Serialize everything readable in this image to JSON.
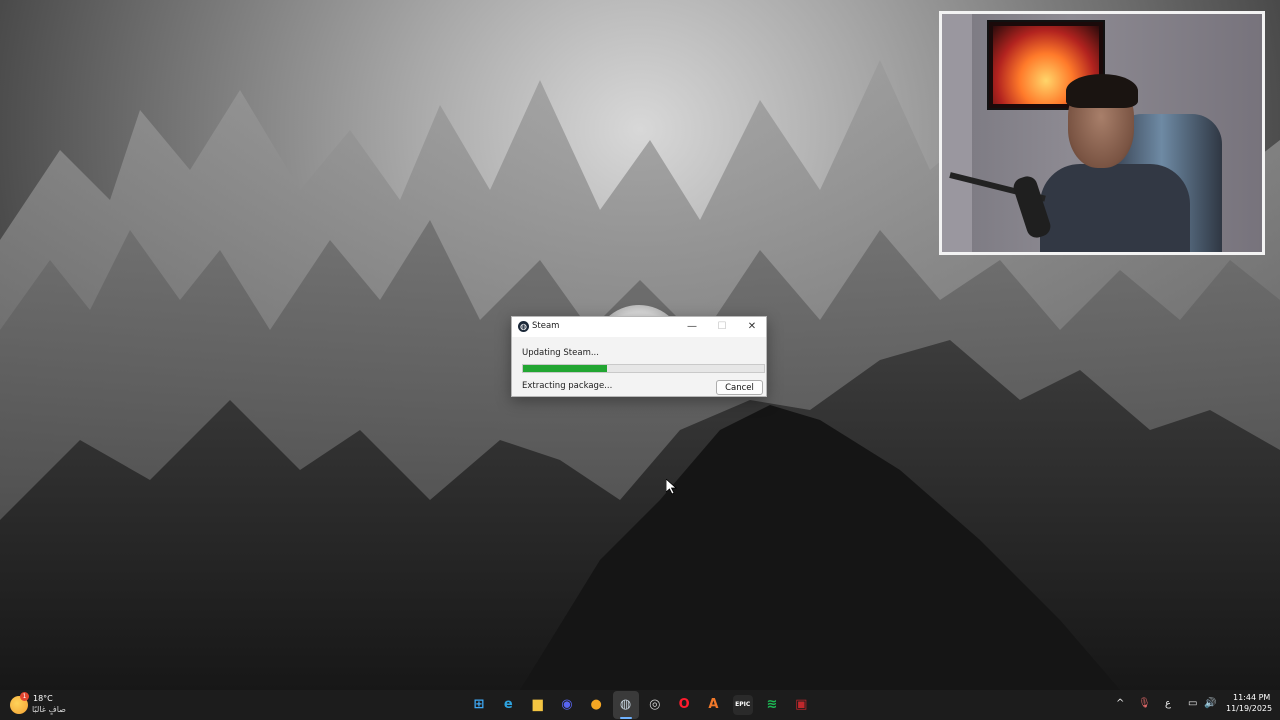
{
  "steam_dialog": {
    "title": "Steam",
    "status_main": "Updating Steam...",
    "status_sub": "Extracting package...",
    "cancel_label": "Cancel",
    "progress": 0.35,
    "progress_color": "#22a632",
    "minimize_glyph": "—",
    "maximize_glyph": "☐",
    "close_glyph": "✕"
  },
  "taskbar": {
    "weather": {
      "temperature": "18°C",
      "description": "صافٍ غالبًا",
      "badge": "1"
    },
    "apps": [
      {
        "name": "start-button",
        "icon": "windows-icon",
        "glyph": "⊞",
        "color": "#3fa9f5"
      },
      {
        "name": "edge-app",
        "icon": "edge-icon",
        "glyph": "e",
        "color": "#2ea3e0"
      },
      {
        "name": "file-explorer-app",
        "icon": "folder-icon",
        "glyph": "▆",
        "color": "#f4c542"
      },
      {
        "name": "discord-app",
        "icon": "discord-icon",
        "glyph": "◉",
        "color": "#5865f2"
      },
      {
        "name": "chat-app",
        "icon": "chat-bubble-icon",
        "glyph": "●",
        "color": "#f5a623"
      },
      {
        "name": "steam-app",
        "icon": "steam-icon",
        "glyph": "◍",
        "color": "#c7d5e0"
      },
      {
        "name": "obs-app",
        "icon": "obs-icon",
        "glyph": "◎",
        "color": "#d0d0d0"
      },
      {
        "name": "opera-app",
        "icon": "opera-icon",
        "glyph": "O",
        "color": "#ff1b2d"
      },
      {
        "name": "launcher-app",
        "icon": "a-launcher-icon",
        "glyph": "A",
        "color": "#f0782a"
      },
      {
        "name": "epic-games-app",
        "icon": "epic-games-icon",
        "glyph": "EPIC",
        "color": "#2a2a2a"
      },
      {
        "name": "spotify-app",
        "icon": "spotify-icon",
        "glyph": "≋",
        "color": "#1db954"
      },
      {
        "name": "game-app",
        "icon": "game-icon",
        "glyph": "▣",
        "color": "#c0282c"
      }
    ],
    "tray": {
      "chevron": "^",
      "language": "ع",
      "time": "11:44 PM",
      "date": "11/19/2025"
    }
  }
}
